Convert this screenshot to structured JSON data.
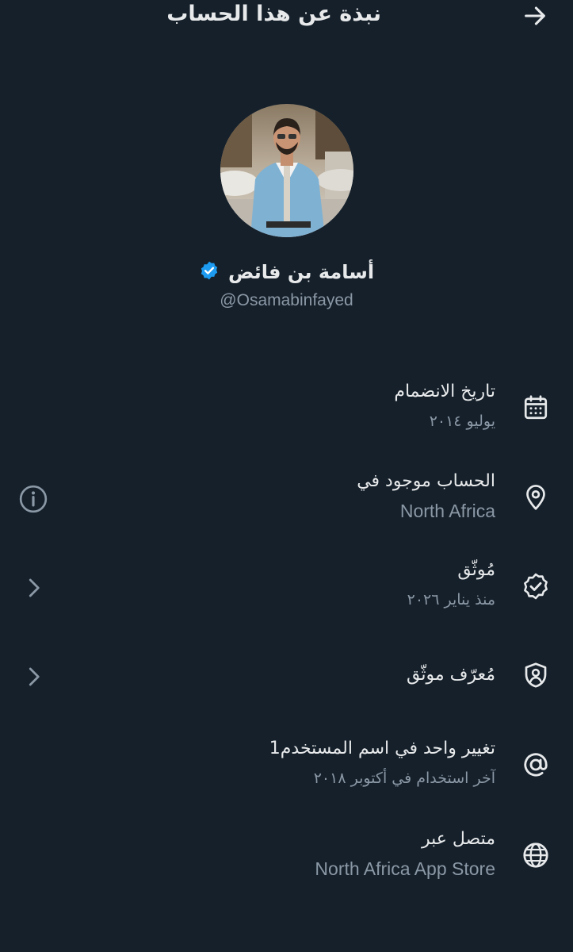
{
  "header": {
    "title": "نبذة عن هذا الحساب",
    "back_icon": "arrow-right-icon"
  },
  "profile": {
    "display_name": "أسامة بن فائض",
    "handle": "@Osamabinfayed",
    "verified_color": "#1d9bf0"
  },
  "rows": [
    {
      "title": "تاريخ الانضمام",
      "subtitle": "يوليو ٢٠١٤",
      "icon": "calendar-icon"
    },
    {
      "title": "الحساب موجود في",
      "subtitle": "North Africa",
      "icon": "location-pin-icon",
      "action_icon": "info-icon"
    },
    {
      "title": "مُوثّق",
      "subtitle": "منذ يناير ٢٠٢٦",
      "icon": "verified-badge-icon",
      "action_icon": "chevron-left-icon"
    },
    {
      "title": "مُعرّف موثّق",
      "subtitle": "",
      "icon": "id-shield-icon",
      "action_icon": "chevron-left-icon"
    },
    {
      "title": "تغيير واحد في اسم المستخدم1",
      "subtitle": "آخر استخدام في أكتوبر ٢٠١٨",
      "icon": "at-sign-icon"
    },
    {
      "title": "متصل عبر",
      "subtitle": "North Africa App Store",
      "icon": "globe-icon"
    }
  ],
  "colors": {
    "background": "#15202b",
    "text_primary": "#e7e9ea",
    "text_secondary": "#8b98a5"
  }
}
